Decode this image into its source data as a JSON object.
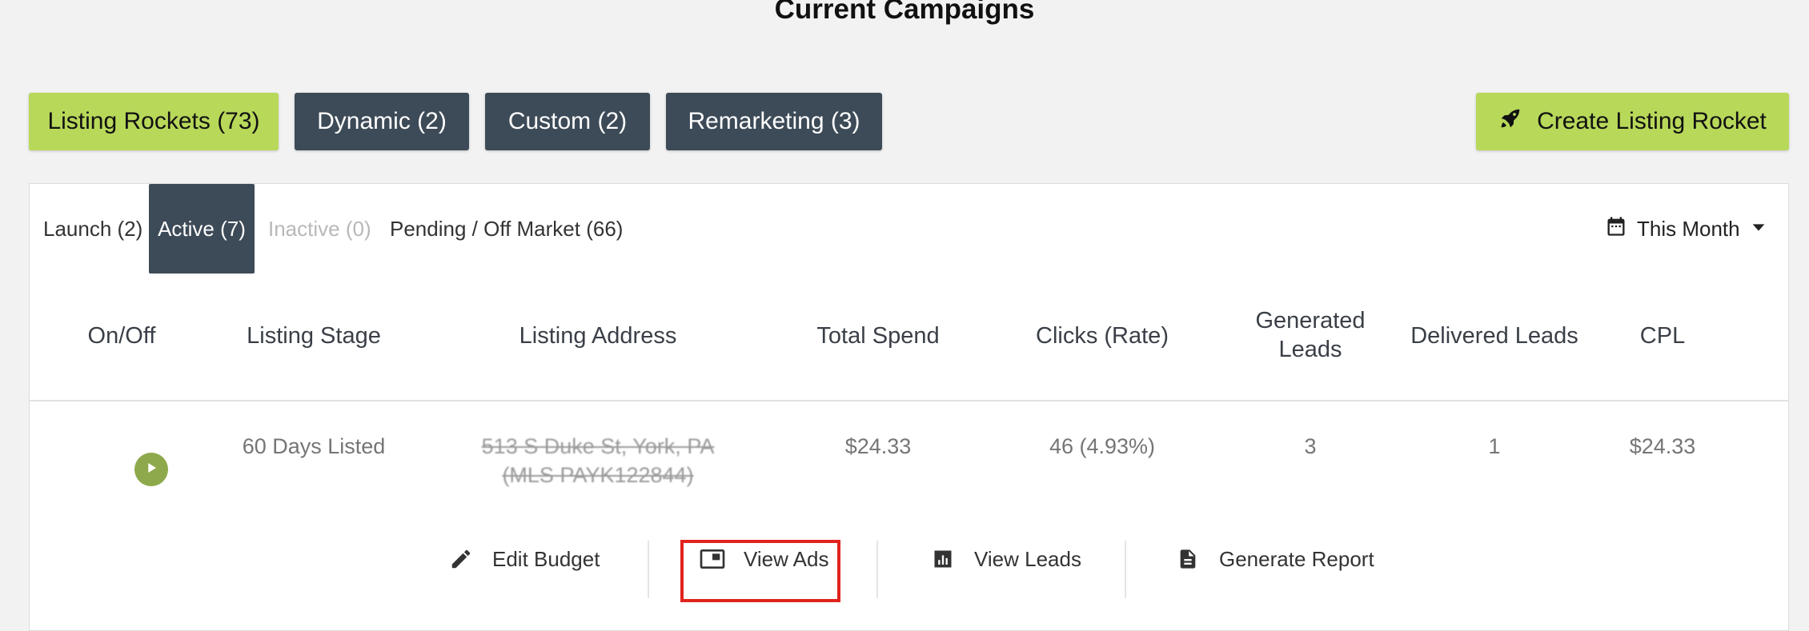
{
  "page": {
    "title": "Current Campaigns"
  },
  "campaign_types": [
    {
      "label": "Listing Rockets (73)",
      "style": "lime"
    },
    {
      "label": "Dynamic (2)",
      "style": "dark"
    },
    {
      "label": "Custom (2)",
      "style": "dark"
    },
    {
      "label": "Remarketing (3)",
      "style": "dark"
    }
  ],
  "create_button": {
    "label": "Create Listing Rocket",
    "icon": "rocket-icon"
  },
  "status_tabs": [
    {
      "label": "Launch (2)",
      "state": "normal"
    },
    {
      "label": "Active (7)",
      "state": "active"
    },
    {
      "label": "Inactive (0)",
      "state": "disabled"
    },
    {
      "label": "Pending / Off Market (66)",
      "state": "normal"
    }
  ],
  "date_filter": {
    "label": "This Month",
    "icon": "calendar-icon"
  },
  "table": {
    "headers": {
      "on_off": "On/Off",
      "stage": "Listing Stage",
      "address": "Listing Address",
      "spend": "Total Spend",
      "clicks": "Clicks (Rate)",
      "gen_leads_1": "Generated",
      "gen_leads_2": "Leads",
      "delivered": "Delivered Leads",
      "cpl": "CPL"
    },
    "rows": [
      {
        "stage": "60 Days Listed",
        "address_line1": "513 S Duke St, York, PA",
        "address_line2": "(MLS PAYK122844)",
        "spend": "$24.33",
        "clicks": "46 (4.93%)",
        "generated": "3",
        "delivered": "1",
        "cpl": "$24.33"
      }
    ]
  },
  "row_actions": {
    "edit_budget": "Edit Budget",
    "view_ads": "View Ads",
    "view_leads": "View Leads",
    "generate_report": "Generate Report"
  },
  "colors": {
    "accent_lime": "#b8d85a",
    "dark_slate": "#3d4a57",
    "play_green": "#8ea94b",
    "highlight_red": "#e0231d"
  }
}
